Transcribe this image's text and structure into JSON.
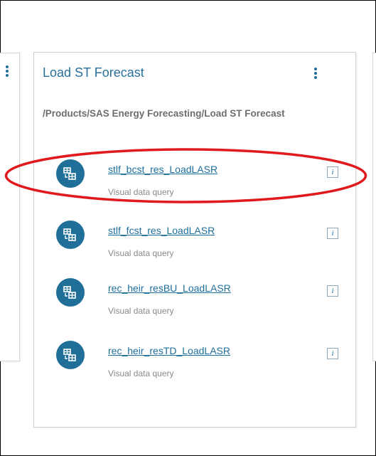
{
  "card": {
    "title": "Load ST Forecast",
    "path": "/Products/SAS Energy Forecasting/Load ST Forecast",
    "menu_icon": "more-vertical-icon",
    "items": [
      {
        "name": "stlf_bcst_res_LoadLASR",
        "type": "Visual data query",
        "icon": "data-query-icon",
        "info_icon": "i",
        "highlighted": true
      },
      {
        "name": "stlf_fcst_res_LoadLASR",
        "type": "Visual data query",
        "icon": "data-query-icon",
        "info_icon": "i",
        "highlighted": false
      },
      {
        "name": "rec_heir_resBU_LoadLASR",
        "type": "Visual data query",
        "icon": "data-query-icon",
        "info_icon": "i",
        "highlighted": false
      },
      {
        "name": "rec_heir_resTD_LoadLASR",
        "type": "Visual data query",
        "icon": "data-query-icon",
        "info_icon": "i",
        "highlighted": false
      }
    ]
  },
  "annotation": {
    "color": "#e0191d"
  }
}
